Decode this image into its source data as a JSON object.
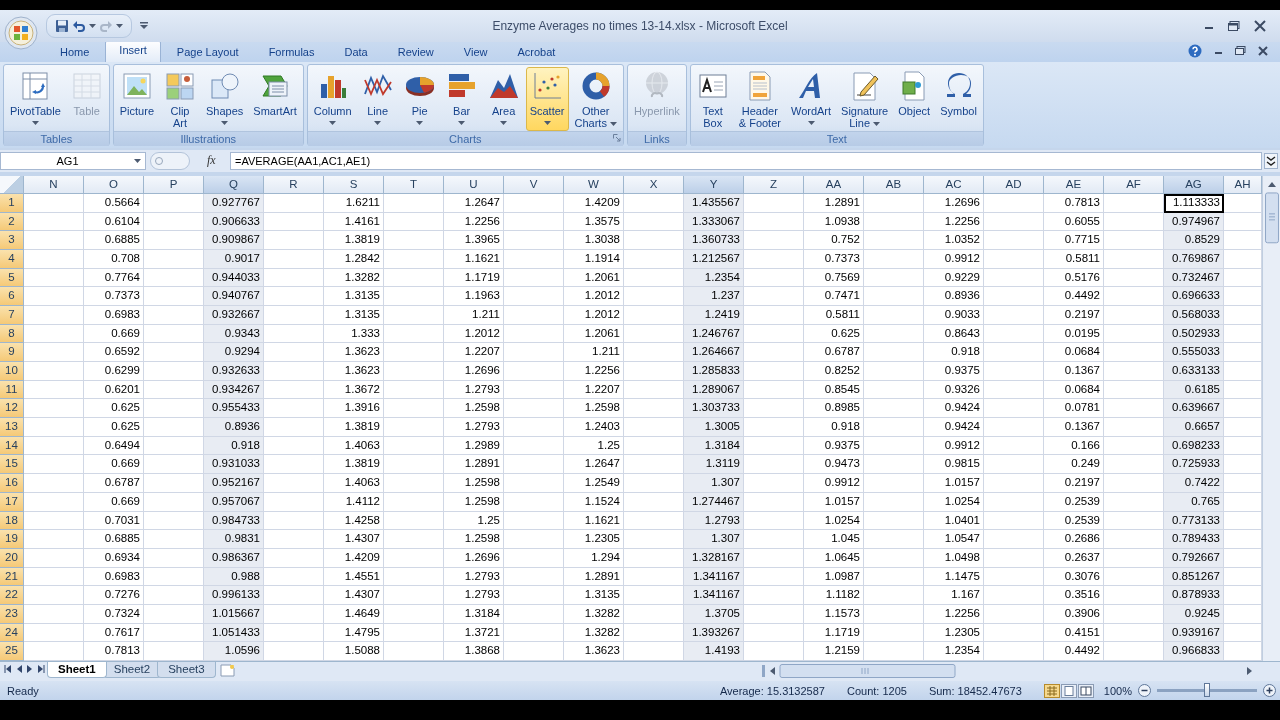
{
  "window": {
    "title": "Enzyme Averages no times 13-14.xlsx - Microsoft Excel"
  },
  "tabs": [
    {
      "label": "Home",
      "selected": false
    },
    {
      "label": "Insert",
      "selected": true
    },
    {
      "label": "Page Layout",
      "selected": false
    },
    {
      "label": "Formulas",
      "selected": false
    },
    {
      "label": "Data",
      "selected": false
    },
    {
      "label": "Review",
      "selected": false
    },
    {
      "label": "View",
      "selected": false
    },
    {
      "label": "Acrobat",
      "selected": false
    }
  ],
  "ribbon": {
    "groups": [
      {
        "label": "Tables",
        "launcher": false,
        "buttons": [
          {
            "label": "PivotTable",
            "dropdown": true,
            "disabled": false,
            "hovered": false
          },
          {
            "label": "Table",
            "dropdown": false,
            "disabled": true,
            "hovered": false
          }
        ]
      },
      {
        "label": "Illustrations",
        "launcher": false,
        "buttons": [
          {
            "label": "Picture",
            "dropdown": false,
            "disabled": false,
            "hovered": false
          },
          {
            "label": "Clip\nArt",
            "dropdown": false,
            "disabled": false,
            "hovered": false
          },
          {
            "label": "Shapes",
            "dropdown": true,
            "disabled": false,
            "hovered": false
          },
          {
            "label": "SmartArt",
            "dropdown": false,
            "disabled": false,
            "hovered": false
          }
        ]
      },
      {
        "label": "Charts",
        "launcher": true,
        "buttons": [
          {
            "label": "Column",
            "dropdown": true,
            "disabled": false,
            "hovered": false
          },
          {
            "label": "Line",
            "dropdown": true,
            "disabled": false,
            "hovered": false
          },
          {
            "label": "Pie",
            "dropdown": true,
            "disabled": false,
            "hovered": false
          },
          {
            "label": "Bar",
            "dropdown": true,
            "disabled": false,
            "hovered": false
          },
          {
            "label": "Area",
            "dropdown": true,
            "disabled": false,
            "hovered": false
          },
          {
            "label": "Scatter",
            "dropdown": true,
            "disabled": false,
            "hovered": true
          },
          {
            "label": "Other\nCharts",
            "dropdown": true,
            "disabled": false,
            "hovered": false
          }
        ]
      },
      {
        "label": "Links",
        "launcher": false,
        "buttons": [
          {
            "label": "Hyperlink",
            "dropdown": false,
            "disabled": true,
            "hovered": false
          }
        ]
      },
      {
        "label": "Text",
        "launcher": false,
        "buttons": [
          {
            "label": "Text\nBox",
            "dropdown": false,
            "disabled": false,
            "hovered": false
          },
          {
            "label": "Header\n& Footer",
            "dropdown": false,
            "disabled": false,
            "hovered": false
          },
          {
            "label": "WordArt",
            "dropdown": true,
            "disabled": false,
            "hovered": false
          },
          {
            "label": "Signature\nLine",
            "dropdown": true,
            "disabled": false,
            "hovered": false
          },
          {
            "label": "Object",
            "dropdown": false,
            "disabled": false,
            "hovered": false
          },
          {
            "label": "Symbol",
            "dropdown": false,
            "disabled": false,
            "hovered": false
          }
        ]
      }
    ]
  },
  "formula_bar": {
    "name_box": "AG1",
    "function_button": "fx",
    "formula": "=AVERAGE(AA1,AC1,AE1)"
  },
  "sheet": {
    "columns": [
      {
        "label": "N",
        "kind": "blank",
        "selected": false,
        "active": false
      },
      {
        "label": "O",
        "kind": "data",
        "selected": false,
        "active": false
      },
      {
        "label": "P",
        "kind": "blank",
        "selected": false,
        "active": false
      },
      {
        "label": "Q",
        "kind": "data",
        "selected": true,
        "active": false
      },
      {
        "label": "R",
        "kind": "blank",
        "selected": false,
        "active": false
      },
      {
        "label": "S",
        "kind": "data",
        "selected": false,
        "active": false
      },
      {
        "label": "T",
        "kind": "blank",
        "selected": false,
        "active": false
      },
      {
        "label": "U",
        "kind": "data",
        "selected": false,
        "active": false
      },
      {
        "label": "V",
        "kind": "blank",
        "selected": false,
        "active": false
      },
      {
        "label": "W",
        "kind": "data",
        "selected": false,
        "active": false
      },
      {
        "label": "X",
        "kind": "blank",
        "selected": false,
        "active": false
      },
      {
        "label": "Y",
        "kind": "data",
        "selected": true,
        "active": false
      },
      {
        "label": "Z",
        "kind": "blank",
        "selected": false,
        "active": false
      },
      {
        "label": "AA",
        "kind": "data",
        "selected": false,
        "active": false
      },
      {
        "label": "AB",
        "kind": "blank",
        "selected": false,
        "active": false
      },
      {
        "label": "AC",
        "kind": "data",
        "selected": false,
        "active": false
      },
      {
        "label": "AD",
        "kind": "blank",
        "selected": false,
        "active": false
      },
      {
        "label": "AE",
        "kind": "data",
        "selected": false,
        "active": false
      },
      {
        "label": "AF",
        "kind": "blank",
        "selected": false,
        "active": false
      },
      {
        "label": "AG",
        "kind": "data",
        "selected": true,
        "active": true
      },
      {
        "label": "AH",
        "kind": "blank",
        "selected": false,
        "active": false
      }
    ],
    "rows": [
      {
        "number": "1",
        "selected": true,
        "active": true,
        "values": [
          "0.5664",
          "0.927767",
          "1.6211",
          "1.2647",
          "1.4209",
          "1.435567",
          "1.2891",
          "1.2696",
          "0.7813",
          "1.113333"
        ]
      },
      {
        "number": "2",
        "selected": true,
        "active": false,
        "values": [
          "0.6104",
          "0.906633",
          "1.4161",
          "1.2256",
          "1.3575",
          "1.333067",
          "1.0938",
          "1.2256",
          "0.6055",
          "0.974967"
        ]
      },
      {
        "number": "3",
        "selected": true,
        "active": false,
        "values": [
          "0.6885",
          "0.909867",
          "1.3819",
          "1.3965",
          "1.3038",
          "1.360733",
          "0.752",
          "1.0352",
          "0.7715",
          "0.8529"
        ]
      },
      {
        "number": "4",
        "selected": true,
        "active": false,
        "values": [
          "0.708",
          "0.9017",
          "1.2842",
          "1.1621",
          "1.1914",
          "1.212567",
          "0.7373",
          "0.9912",
          "0.5811",
          "0.769867"
        ]
      },
      {
        "number": "5",
        "selected": true,
        "active": false,
        "values": [
          "0.7764",
          "0.944033",
          "1.3282",
          "1.1719",
          "1.2061",
          "1.2354",
          "0.7569",
          "0.9229",
          "0.5176",
          "0.732467"
        ]
      },
      {
        "number": "6",
        "selected": true,
        "active": false,
        "values": [
          "0.7373",
          "0.940767",
          "1.3135",
          "1.1963",
          "1.2012",
          "1.237",
          "0.7471",
          "0.8936",
          "0.4492",
          "0.696633"
        ]
      },
      {
        "number": "7",
        "selected": true,
        "active": false,
        "values": [
          "0.6983",
          "0.932667",
          "1.3135",
          "1.211",
          "1.2012",
          "1.2419",
          "0.5811",
          "0.9033",
          "0.2197",
          "0.568033"
        ]
      },
      {
        "number": "8",
        "selected": true,
        "active": false,
        "values": [
          "0.669",
          "0.9343",
          "1.333",
          "1.2012",
          "1.2061",
          "1.246767",
          "0.625",
          "0.8643",
          "0.0195",
          "0.502933"
        ]
      },
      {
        "number": "9",
        "selected": true,
        "active": false,
        "values": [
          "0.6592",
          "0.9294",
          "1.3623",
          "1.2207",
          "1.211",
          "1.264667",
          "0.6787",
          "0.918",
          "0.0684",
          "0.555033"
        ]
      },
      {
        "number": "10",
        "selected": true,
        "active": false,
        "values": [
          "0.6299",
          "0.932633",
          "1.3623",
          "1.2696",
          "1.2256",
          "1.285833",
          "0.8252",
          "0.9375",
          "0.1367",
          "0.633133"
        ]
      },
      {
        "number": "11",
        "selected": true,
        "active": false,
        "values": [
          "0.6201",
          "0.934267",
          "1.3672",
          "1.2793",
          "1.2207",
          "1.289067",
          "0.8545",
          "0.9326",
          "0.0684",
          "0.6185"
        ]
      },
      {
        "number": "12",
        "selected": true,
        "active": false,
        "values": [
          "0.625",
          "0.955433",
          "1.3916",
          "1.2598",
          "1.2598",
          "1.303733",
          "0.8985",
          "0.9424",
          "0.0781",
          "0.639667"
        ]
      },
      {
        "number": "13",
        "selected": true,
        "active": false,
        "values": [
          "0.625",
          "0.8936",
          "1.3819",
          "1.2793",
          "1.2403",
          "1.3005",
          "0.918",
          "0.9424",
          "0.1367",
          "0.6657"
        ]
      },
      {
        "number": "14",
        "selected": true,
        "active": false,
        "values": [
          "0.6494",
          "0.918",
          "1.4063",
          "1.2989",
          "1.25",
          "1.3184",
          "0.9375",
          "0.9912",
          "0.166",
          "0.698233"
        ]
      },
      {
        "number": "15",
        "selected": true,
        "active": false,
        "values": [
          "0.669",
          "0.931033",
          "1.3819",
          "1.2891",
          "1.2647",
          "1.3119",
          "0.9473",
          "0.9815",
          "0.249",
          "0.725933"
        ]
      },
      {
        "number": "16",
        "selected": true,
        "active": false,
        "values": [
          "0.6787",
          "0.952167",
          "1.4063",
          "1.2598",
          "1.2549",
          "1.307",
          "0.9912",
          "1.0157",
          "0.2197",
          "0.7422"
        ]
      },
      {
        "number": "17",
        "selected": true,
        "active": false,
        "values": [
          "0.669",
          "0.957067",
          "1.4112",
          "1.2598",
          "1.1524",
          "1.274467",
          "1.0157",
          "1.0254",
          "0.2539",
          "0.765"
        ]
      },
      {
        "number": "18",
        "selected": true,
        "active": false,
        "values": [
          "0.7031",
          "0.984733",
          "1.4258",
          "1.25",
          "1.1621",
          "1.2793",
          "1.0254",
          "1.0401",
          "0.2539",
          "0.773133"
        ]
      },
      {
        "number": "19",
        "selected": true,
        "active": false,
        "values": [
          "0.6885",
          "0.9831",
          "1.4307",
          "1.2598",
          "1.2305",
          "1.307",
          "1.045",
          "1.0547",
          "0.2686",
          "0.789433"
        ]
      },
      {
        "number": "20",
        "selected": true,
        "active": false,
        "values": [
          "0.6934",
          "0.986367",
          "1.4209",
          "1.2696",
          "1.294",
          "1.328167",
          "1.0645",
          "1.0498",
          "0.2637",
          "0.792667"
        ]
      },
      {
        "number": "21",
        "selected": true,
        "active": false,
        "values": [
          "0.6983",
          "0.988",
          "1.4551",
          "1.2793",
          "1.2891",
          "1.341167",
          "1.0987",
          "1.1475",
          "0.3076",
          "0.851267"
        ]
      },
      {
        "number": "22",
        "selected": true,
        "active": false,
        "values": [
          "0.7276",
          "0.996133",
          "1.4307",
          "1.2793",
          "1.3135",
          "1.341167",
          "1.1182",
          "1.167",
          "0.3516",
          "0.878933"
        ]
      },
      {
        "number": "23",
        "selected": true,
        "active": false,
        "values": [
          "0.7324",
          "1.015667",
          "1.4649",
          "1.3184",
          "1.3282",
          "1.3705",
          "1.1573",
          "1.2256",
          "0.3906",
          "0.9245"
        ]
      },
      {
        "number": "24",
        "selected": true,
        "active": false,
        "values": [
          "0.7617",
          "1.051433",
          "1.4795",
          "1.3721",
          "1.3282",
          "1.393267",
          "1.1719",
          "1.2305",
          "0.4151",
          "0.939167"
        ]
      },
      {
        "number": "25",
        "selected": true,
        "active": false,
        "values": [
          "0.7813",
          "1.0596",
          "1.5088",
          "1.3868",
          "1.3623",
          "1.4193",
          "1.2159",
          "1.2354",
          "0.4492",
          "0.966833"
        ]
      }
    ]
  },
  "sheet_tabs": [
    {
      "label": "Sheet1",
      "selected": true
    },
    {
      "label": "Sheet2",
      "selected": false
    },
    {
      "label": "Sheet3",
      "selected": false
    }
  ],
  "status_bar": {
    "mode": "Ready",
    "average": "Average: 15.3132587",
    "count": "Count: 1205",
    "sum": "Sum: 18452.47673",
    "zoom": {
      "label": "100%",
      "level": 0.5
    }
  }
}
